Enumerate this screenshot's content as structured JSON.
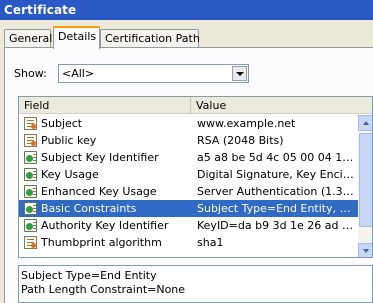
{
  "window": {
    "title": "Certificate"
  },
  "tabs": [
    {
      "label": "General"
    },
    {
      "label": "Details"
    },
    {
      "label": "Certification Path"
    }
  ],
  "show": {
    "label": "Show:",
    "selected": "<All>"
  },
  "list": {
    "columns": {
      "field": "Field",
      "value": "Value"
    },
    "rows": [
      {
        "field": "Subject",
        "value": "www.example.net",
        "icon": "certificate-field-icon"
      },
      {
        "field": "Public key",
        "value": "RSA (2048 Bits)",
        "icon": "certificate-field-icon"
      },
      {
        "field": "Subject Key Identifier",
        "value": "a5 a8 be 5d 4c 05 00 04 12 1b...",
        "icon": "extension-icon"
      },
      {
        "field": "Key Usage",
        "value": "Digital Signature, Key Encipher...",
        "icon": "extension-icon"
      },
      {
        "field": "Enhanced Key Usage",
        "value": "Server Authentication (1.3.6....",
        "icon": "extension-icon"
      },
      {
        "field": "Basic Constraints",
        "value": "Subject Type=End Entity, Pat...",
        "icon": "extension-icon",
        "selected": true
      },
      {
        "field": "Authority Key Identifier",
        "value": "KeyID=da b9 3d 1e 26 ad 28 ...",
        "icon": "extension-icon"
      },
      {
        "field": "Thumbprint algorithm",
        "value": "sha1",
        "icon": "certificate-field-icon"
      }
    ]
  },
  "details": {
    "lines": [
      "Subject Type=End Entity",
      "Path Length Constraint=None"
    ]
  },
  "colors": {
    "titlebar": "#2a59c6",
    "selection": "#316ac5",
    "tab_highlight": "#ff9a00"
  }
}
